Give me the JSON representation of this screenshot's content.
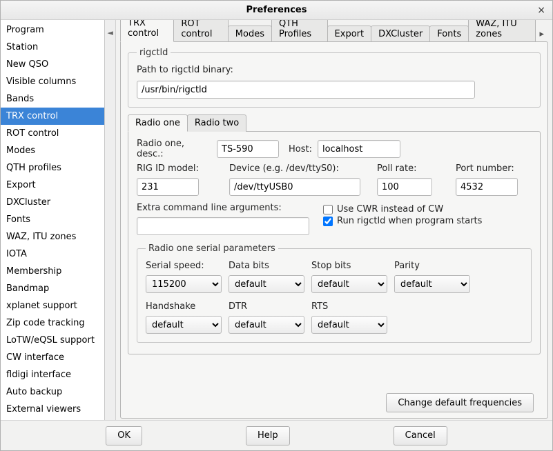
{
  "window": {
    "title": "Preferences",
    "close_label": "×"
  },
  "sidebar": {
    "items": [
      {
        "label": "Program"
      },
      {
        "label": "Station"
      },
      {
        "label": "New QSO"
      },
      {
        "label": "Visible columns"
      },
      {
        "label": "Bands"
      },
      {
        "label": "TRX control",
        "selected": true
      },
      {
        "label": "ROT control"
      },
      {
        "label": "Modes"
      },
      {
        "label": "QTH profiles"
      },
      {
        "label": "Export"
      },
      {
        "label": "DXCluster"
      },
      {
        "label": "Fonts"
      },
      {
        "label": "WAZ, ITU zones"
      },
      {
        "label": "IOTA"
      },
      {
        "label": "Membership"
      },
      {
        "label": "Bandmap"
      },
      {
        "label": "xplanet support"
      },
      {
        "label": "Zip code tracking"
      },
      {
        "label": "LoTW/eQSL support"
      },
      {
        "label": "CW interface"
      },
      {
        "label": "fldigi interface"
      },
      {
        "label": "Auto backup"
      },
      {
        "label": "External viewers"
      }
    ]
  },
  "tabs": [
    {
      "label": "TRX control",
      "active": true
    },
    {
      "label": "ROT control"
    },
    {
      "label": "Modes"
    },
    {
      "label": "QTH Profiles"
    },
    {
      "label": "Export"
    },
    {
      "label": "DXCluster"
    },
    {
      "label": "Fonts"
    },
    {
      "label": "WAZ, ITU zones"
    }
  ],
  "rigctld": {
    "legend": "rigctld",
    "path_label": "Path to rigctld binary:",
    "path_value": "/usr/bin/rigctld"
  },
  "radio_tabs": [
    {
      "label": "Radio one",
      "active": true
    },
    {
      "label": "Radio two"
    }
  ],
  "radio_one": {
    "desc_label": "Radio one, desc.:",
    "desc_value": "TS-590",
    "host_label": "Host:",
    "host_value": "localhost",
    "rig_id_label": "RIG ID model:",
    "rig_id_value": "231",
    "device_label": "Device (e.g. /dev/ttyS0):",
    "device_value": "/dev/ttyUSB0",
    "poll_label": "Poll rate:",
    "poll_value": "100",
    "port_label": "Port number:",
    "port_value": "4532",
    "extra_label": "Extra command line arguments:",
    "extra_value": "",
    "cwr_label": "Use CWR instead of CW",
    "cwr_checked": false,
    "run_label": "Run rigctld when program starts",
    "run_checked": true,
    "serial_legend": "Radio one serial parameters",
    "serial": {
      "speed_label": "Serial speed:",
      "speed_value": "115200",
      "databits_label": "Data bits",
      "databits_value": "default",
      "stopbits_label": "Stop bits",
      "stopbits_value": "default",
      "parity_label": "Parity",
      "parity_value": "default",
      "handshake_label": "Handshake",
      "handshake_value": "default",
      "dtr_label": "DTR",
      "dtr_value": "default",
      "rts_label": "RTS",
      "rts_value": "default"
    },
    "change_freq_label": "Change default frequencies"
  },
  "footer": {
    "ok": "OK",
    "help": "Help",
    "cancel": "Cancel"
  }
}
